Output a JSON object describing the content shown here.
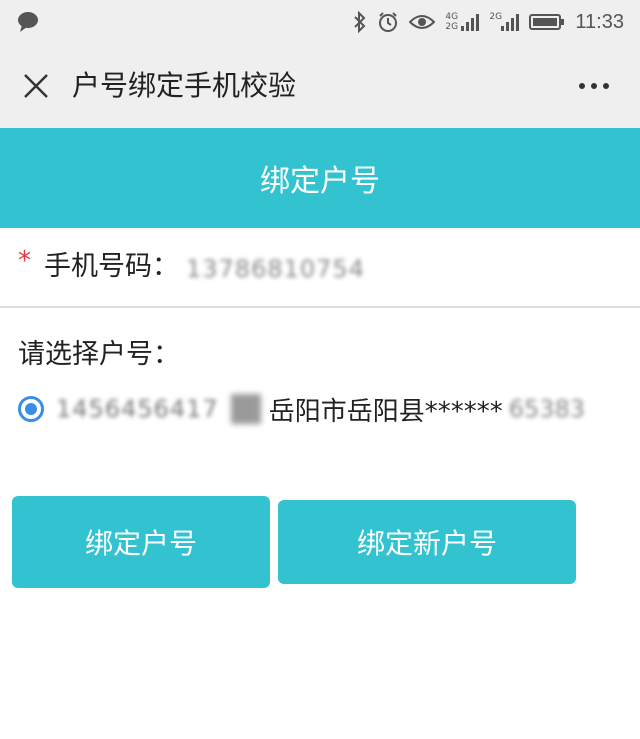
{
  "status_bar": {
    "time": "11:33",
    "net_label_1": "4G",
    "net_label_2": "2G",
    "net_label_3": "2G",
    "icons": [
      "chat-bubble-icon",
      "bluetooth-icon",
      "alarm-icon",
      "eye-icon",
      "signal-icon",
      "signal-icon",
      "battery-icon"
    ]
  },
  "title_bar": {
    "title": "户号绑定手机校验",
    "close_icon": "close-icon",
    "more_icon": "more-icon"
  },
  "banner": {
    "title": "绑定户号"
  },
  "form": {
    "required_mark": "*",
    "phone_label": "手机号码：",
    "phone_value": "13786810754",
    "select_label": "请选择户号：",
    "accounts": [
      {
        "selected": true,
        "number": "1456456417",
        "region": "岳阳市岳阳县******",
        "suffix": "65383"
      }
    ]
  },
  "buttons": {
    "bind_label": "绑定户号",
    "bind_new_label": "绑定新户号"
  },
  "colors": {
    "accent": "#33c3d0",
    "radio": "#3a8ee6",
    "required": "#e23b3b",
    "chrome": "#efefef"
  }
}
